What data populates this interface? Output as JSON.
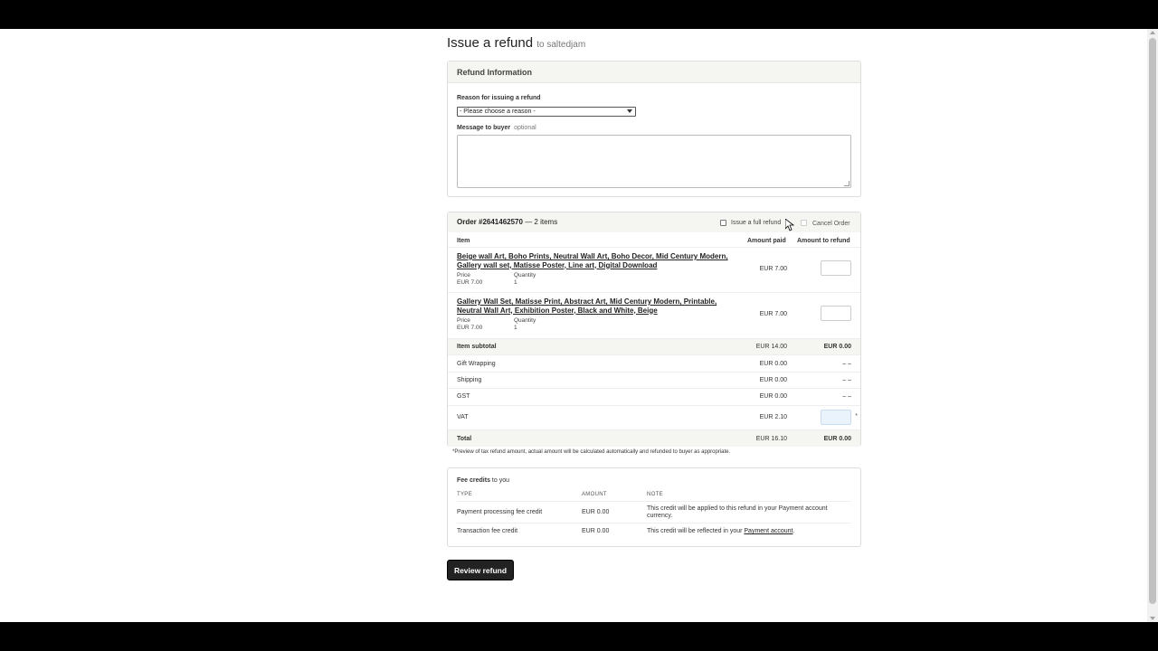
{
  "page": {
    "title": "Issue a refund",
    "subtitle": "to saltedjam"
  },
  "refund_info": {
    "heading": "Refund Information",
    "reason_label": "Reason for issuing a refund",
    "reason_selected": "- Please choose a reason -",
    "message_label": "Message to buyer",
    "message_optional": "optional",
    "message_value": ""
  },
  "order": {
    "title": "Order #2641462570",
    "item_count": "— 2 items",
    "full_refund_label": "Issue a full refund",
    "full_refund_checked": false,
    "cancel_label": "Cancel Order",
    "cancel_checked": false,
    "columns": {
      "item": "Item",
      "amount_paid": "Amount paid",
      "amount_refund": "Amount to refund"
    },
    "items": [
      {
        "title": "Beige wall Art, Boho Prints, Neutral Wall Art, Boho Decor, Mid Century Modern, Gallery wall set, Matisse Poster, Line art, Digital Download",
        "price_label": "Price",
        "price": "EUR 7.00",
        "quantity_label": "Quantity",
        "quantity": "1",
        "amount_paid": "EUR 7.00",
        "refund_value": ""
      },
      {
        "title": "Gallery Wall Set, Matisse Print, Abstract Art, Mid Century Modern, Printable, Neutral Wall Art, Exhibition Poster, Black and White, Beige",
        "price_label": "Price",
        "price": "EUR 7.00",
        "quantity_label": "Quantity",
        "quantity": "1",
        "amount_paid": "EUR 7.00",
        "refund_value": ""
      }
    ],
    "summary": [
      {
        "name": "Item subtotal",
        "paid": "EUR 14.00",
        "refund": "EUR 0.00"
      },
      {
        "name": "Gift Wrapping",
        "paid": "EUR 0.00",
        "refund": "– –"
      },
      {
        "name": "Shipping",
        "paid": "EUR 0.00",
        "refund": "– –"
      },
      {
        "name": "GST",
        "paid": "EUR 0.00",
        "refund": "– –"
      },
      {
        "name": "VAT",
        "paid": "EUR 2.10",
        "refund": "*"
      },
      {
        "name": "Total",
        "paid": "EUR 16.10",
        "refund": "EUR 0.00"
      }
    ],
    "footnote": "*Preview of tax refund amount, actual amount will be calculated automatically and refunded to buyer as appropriate."
  },
  "fees": {
    "title_bold": "Fee credits",
    "title_rest": " to you",
    "columns": {
      "type": "TYPE",
      "amount": "AMOUNT",
      "note": "NOTE"
    },
    "rows": [
      {
        "type": "Payment processing fee credit",
        "amount": "EUR 0.00",
        "note": "This credit will be applied to this refund in your Payment account currency."
      },
      {
        "type": "Transaction fee credit",
        "amount": "EUR 0.00",
        "note_prefix": "This credit will be reflected in your ",
        "note_link": "Payment account",
        "note_suffix": "."
      }
    ]
  },
  "actions": {
    "review_label": "Review refund"
  }
}
